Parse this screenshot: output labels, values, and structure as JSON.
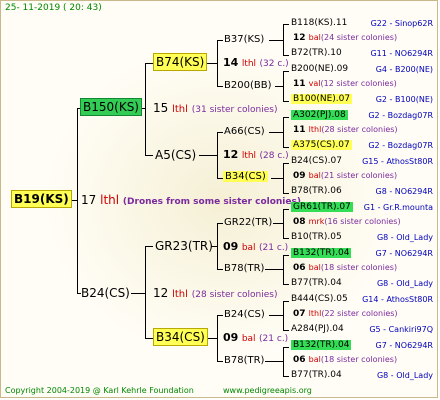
{
  "header_date": "25- 11-2019 ( 20: 43)",
  "footer_left": "Copyright 2004-2019 @ Karl Kehrle Foundation",
  "footer_right": "www.pedigreeapis.org",
  "root": {
    "label": "B19(KS)",
    "num": "17",
    "unit": "lthl",
    "note": "(Drones from some sister colonies)"
  },
  "gen1": {
    "top": {
      "label": "B150(KS)",
      "num": "15",
      "unit": "lthl",
      "note": "(31 sister colonies)"
    },
    "bottom": {
      "label": "B24(CS)",
      "num": "12",
      "unit": "lthl",
      "note": "(28 sister colonies)"
    }
  },
  "gen2": {
    "b74": {
      "label": "B74(KS)",
      "num": "14",
      "unit": "lthl",
      "note": "(32 c.)"
    },
    "a5": {
      "label": "A5(CS)",
      "num": "12",
      "unit": "lthl",
      "note": "(28 c.)"
    },
    "gr23": {
      "label": "GR23(TR)",
      "num": "09",
      "unit": "bal",
      "note": "(21 c.)"
    },
    "b34": {
      "label": "B34(CS)",
      "num": "09",
      "unit": "bal",
      "note": "(21 c.)"
    }
  },
  "gen3": {
    "b37": "B37(KS)",
    "b200": "B200(BB)",
    "a66": "A66(CS)",
    "b34cs": "B34(CS)",
    "gr22": "GR22(TR)",
    "b78a": "B78(TR)",
    "b24cs": "B24(CS)",
    "b78b": "B78(TR)"
  },
  "gen4": [
    {
      "name": "B118(KS).11",
      "right": "G22 - Sinop62R",
      "hl": ""
    },
    {
      "num": "12",
      "unit": "bal",
      "note": "(24 sister colonies)"
    },
    {
      "name": "B72(TR).10",
      "right": "G11 - NO6294R",
      "hl": ""
    },
    {
      "name": "B200(NE).09",
      "right": "G4 - B200(NE)",
      "hl": ""
    },
    {
      "num": "11",
      "unit": "val",
      "note": "(12 sister colonies)"
    },
    {
      "name": "B100(NE).07",
      "right": "G2 - B100(NE)",
      "hl": "y"
    },
    {
      "name": "A302(PJ).08",
      "right": "G2 - Bozdag07R",
      "hl": "g"
    },
    {
      "num": "11",
      "unit": "lthl",
      "note": "(28 sister colonies)"
    },
    {
      "name": "A375(CS).07",
      "right": "G2 - Bozdag07R",
      "hl": "y"
    },
    {
      "name": "B24(CS).07",
      "right": "G15 - AthosSt80R",
      "hl": ""
    },
    {
      "num": "09",
      "unit": "bal",
      "note": "(21 sister colonies)"
    },
    {
      "name": "B78(TR).06",
      "right": "G8 - NO6294R",
      "hl": ""
    },
    {
      "name": "GR61(TR).07",
      "right": "G1 - Gr.R.mounta",
      "hl": "g"
    },
    {
      "num": "08",
      "unit": "mrk",
      "note": "(16 sister colonies)"
    },
    {
      "name": "B10(TR).05",
      "right": "G8 - Old_Lady",
      "hl": ""
    },
    {
      "name": "B132(TR).04",
      "right": "G7 - NO6294R",
      "hl": "g"
    },
    {
      "num": "06",
      "unit": "bal",
      "note": "(18 sister colonies)"
    },
    {
      "name": "B77(TR).04",
      "right": "G8 - Old_Lady",
      "hl": ""
    },
    {
      "name": "B444(CS).05",
      "right": "G14 - AthosSt80R",
      "hl": ""
    },
    {
      "num": "07",
      "unit": "lthl",
      "note": "(22 sister colonies)"
    },
    {
      "name": "A284(PJ).04",
      "right": "G5 - Cankiri97Q",
      "hl": ""
    },
    {
      "name": "B132(TR).04",
      "right": "G7 - NO6294R",
      "hl": "g"
    },
    {
      "num": "06",
      "unit": "bal",
      "note": "(18 sister colonies)"
    },
    {
      "name": "B77(TR).04",
      "right": "G8 - Old_Lady",
      "hl": ""
    }
  ],
  "colors": {
    "yellow": "#ffff55",
    "green": "#33cc55",
    "red": "#cc0000",
    "blue": "#0000cc",
    "purple": "#7b2a9e"
  }
}
